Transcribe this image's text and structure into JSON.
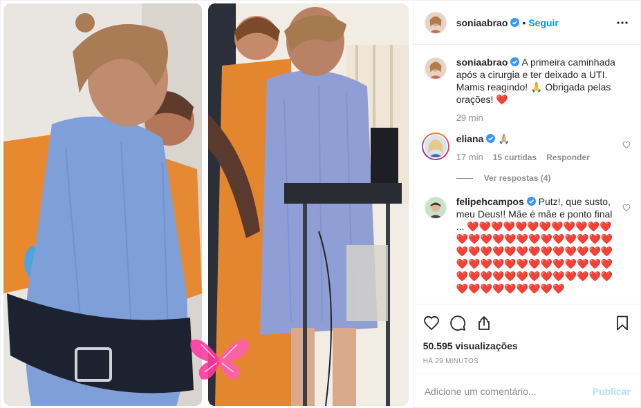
{
  "colors": {
    "accent": "#0095f6",
    "text": "#262626",
    "muted": "#8e8e8e",
    "publish_disabled": "#b2dffc",
    "heart": "#ed4956"
  },
  "header": {
    "username": "soniaabrao",
    "follow_label": "Seguir",
    "separator": "•",
    "more_icon": "ellipsis-icon"
  },
  "caption": {
    "username": "soniaabrao",
    "text": "A primeira caminhada após a cirurgia e ter deixado a UTI. Mamis reagindo! 🙏 Obrigada pelas orações! ❤️",
    "time": "29 min"
  },
  "comments": [
    {
      "username": "eliana",
      "text": "🙏🏼",
      "time": "17 min",
      "likes": "15 curtidas",
      "reply_label": "Responder",
      "view_replies": "Ver respostas (4)"
    },
    {
      "username": "felipehcampos",
      "text": "Putz!, que susto, meu Deus!! Mãe é mãe e ponto final ... ❤️❤️❤️❤️❤️❤️❤️❤️❤️❤️❤️❤️❤️❤️❤️❤️❤️❤️❤️❤️❤️❤️❤️❤️❤️❤️❤️❤️❤️❤️❤️❤️❤️❤️❤️❤️❤️❤️❤️❤️❤️❤️❤️❤️❤️❤️❤️❤️❤️❤️❤️❤️❤️❤️❤️❤️❤️❤️❤️❤️❤️❤️❤️❤️❤️❤️❤️❤️❤️❤️❤️❤️❤️"
    }
  ],
  "actions": {
    "icons": [
      "heart-icon",
      "comment-icon",
      "share-icon",
      "bookmark-icon"
    ]
  },
  "stats": {
    "views": "50.595 visualizações",
    "posted": "HÁ 29 MINUTOS"
  },
  "add_comment": {
    "placeholder": "Adicione um comentário...",
    "publish_label": "Publicar"
  }
}
